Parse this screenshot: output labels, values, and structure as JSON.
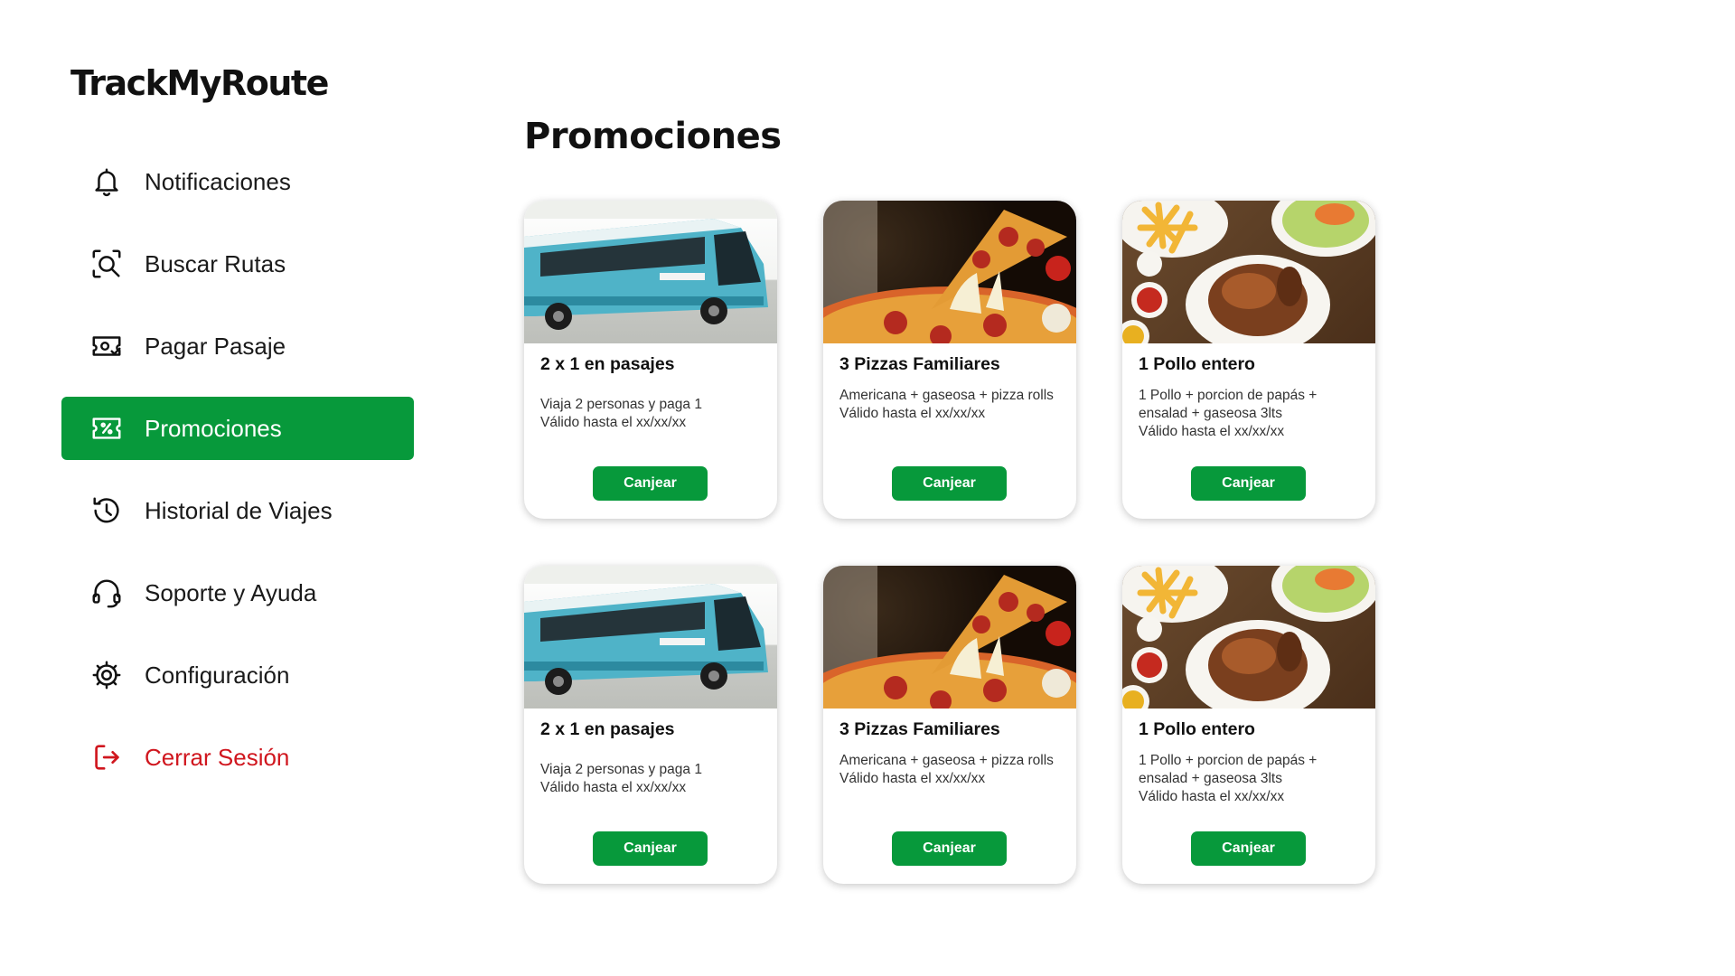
{
  "app": {
    "logo": "TrackMyRoute"
  },
  "sidebar": {
    "items": [
      {
        "label": "Notificaciones",
        "icon": "bell-icon"
      },
      {
        "label": "Buscar Rutas",
        "icon": "search-route-icon"
      },
      {
        "label": "Pagar Pasaje",
        "icon": "ticket-pay-icon"
      },
      {
        "label": "Promociones",
        "icon": "coupon-icon",
        "active": true
      },
      {
        "label": "Historial de Viajes",
        "icon": "history-icon"
      },
      {
        "label": "Soporte y Ayuda",
        "icon": "headset-icon"
      },
      {
        "label": "Configuración",
        "icon": "gear-icon"
      },
      {
        "label": "Cerrar Sesión",
        "icon": "logout-icon"
      }
    ]
  },
  "main": {
    "title": "Promociones"
  },
  "promotions": [
    {
      "image": "bus-photo",
      "title": "2 x 1 en pasajes",
      "desc_line1": "Viaja 2 personas y paga 1",
      "desc_line2": "Válido hasta el xx/xx/xx",
      "desc_line3": "",
      "button": "Canjear"
    },
    {
      "image": "pizza-photo",
      "title": "3 Pizzas Familiares",
      "desc_line1": "Americana + gaseosa + pizza rolls",
      "desc_line2": "Válido hasta el xx/xx/xx",
      "desc_line3": "",
      "button": "Canjear"
    },
    {
      "image": "chicken-photo",
      "title": "1 Pollo entero",
      "desc_line1": "1 Pollo + porcion de papás + ensalad + gaseosa 3lts",
      "desc_line2": "Válido hasta el xx/xx/xx",
      "desc_line3": "",
      "button": "Canjear"
    },
    {
      "image": "bus-photo",
      "title": "2 x 1 en pasajes",
      "desc_line1": "Viaja 2 personas y paga 1",
      "desc_line2": "Válido hasta el xx/xx/xx",
      "desc_line3": "",
      "button": "Canjear"
    },
    {
      "image": "pizza-photo",
      "title": "3 Pizzas Familiares",
      "desc_line1": "Americana + gaseosa + pizza rolls",
      "desc_line2": "Válido hasta el xx/xx/xx",
      "desc_line3": "",
      "button": "Canjear"
    },
    {
      "image": "chicken-photo",
      "title": "1 Pollo entero",
      "desc_line1": "1 Pollo + porcion de papás + ensalad + gaseosa 3lts",
      "desc_line2": "Válido hasta el xx/xx/xx",
      "desc_line3": "",
      "button": "Canjear"
    }
  ],
  "colors": {
    "accent": "#07993b",
    "logout": "#d0161e"
  }
}
